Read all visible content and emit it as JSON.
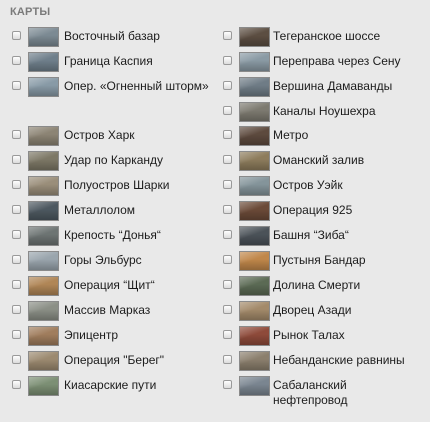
{
  "section": {
    "title": "КАРТЫ"
  },
  "left": [
    {
      "label": "Восточный базар",
      "thumb_color": "#7c8a93"
    },
    {
      "label": "Граница Каспия",
      "thumb_color": "#6f7f8b"
    },
    {
      "label": "Опер. «Огненный шторм»",
      "thumb_color": "#889aa6"
    },
    {
      "label": "Остров Харк",
      "thumb_color": "#8c8474"
    },
    {
      "label": "Удар по Карканду",
      "thumb_color": "#7d7866"
    },
    {
      "label": "Полуостров Шарки",
      "thumb_color": "#9a8e7a"
    },
    {
      "label": "Металлолом",
      "thumb_color": "#4d5860"
    },
    {
      "label": "Крепость “Донья“",
      "thumb_color": "#6d7473"
    },
    {
      "label": "Горы Эльбурс",
      "thumb_color": "#9aa5ad"
    },
    {
      "label": "Операция “Щит“",
      "thumb_color": "#b08656"
    },
    {
      "label": "Массив Марказ",
      "thumb_color": "#8b8f86"
    },
    {
      "label": "Эпицентр",
      "thumb_color": "#a07d5d"
    },
    {
      "label": "Операция \"Берег\"",
      "thumb_color": "#9c8a70"
    },
    {
      "label": "Киасарские пути",
      "thumb_color": "#7c8f74"
    }
  ],
  "right": [
    {
      "label": "Тегеранское шоссе",
      "thumb_color": "#5c4e42"
    },
    {
      "label": "Переправа через Сену",
      "thumb_color": "#8a9aa4"
    },
    {
      "label": "Вершина Дамаванды",
      "thumb_color": "#6f7c86"
    },
    {
      "label": "Каналы Ноушехра",
      "thumb_color": "#7d7a70"
    },
    {
      "label": "Метро",
      "thumb_color": "#5d4a3e"
    },
    {
      "label": "Оманский залив",
      "thumb_color": "#8d7c5c"
    },
    {
      "label": "Остров Уэйк",
      "thumb_color": "#84949a"
    },
    {
      "label": "Операция 925",
      "thumb_color": "#6b4a38"
    },
    {
      "label": "Башня “Зиба“",
      "thumb_color": "#4b5258"
    },
    {
      "label": "Пустыня Бандар",
      "thumb_color": "#c0874a"
    },
    {
      "label": "Долина Смерти",
      "thumb_color": "#5b6a54"
    },
    {
      "label": "Дворец Азади",
      "thumb_color": "#a38a6a"
    },
    {
      "label": "Рынок Талах",
      "thumb_color": "#8e4a3a"
    },
    {
      "label": "Небанданские равнины",
      "thumb_color": "#8b7f6d"
    },
    {
      "label": "Сабаланский нефтепровод",
      "thumb_color": "#7a8590"
    }
  ]
}
